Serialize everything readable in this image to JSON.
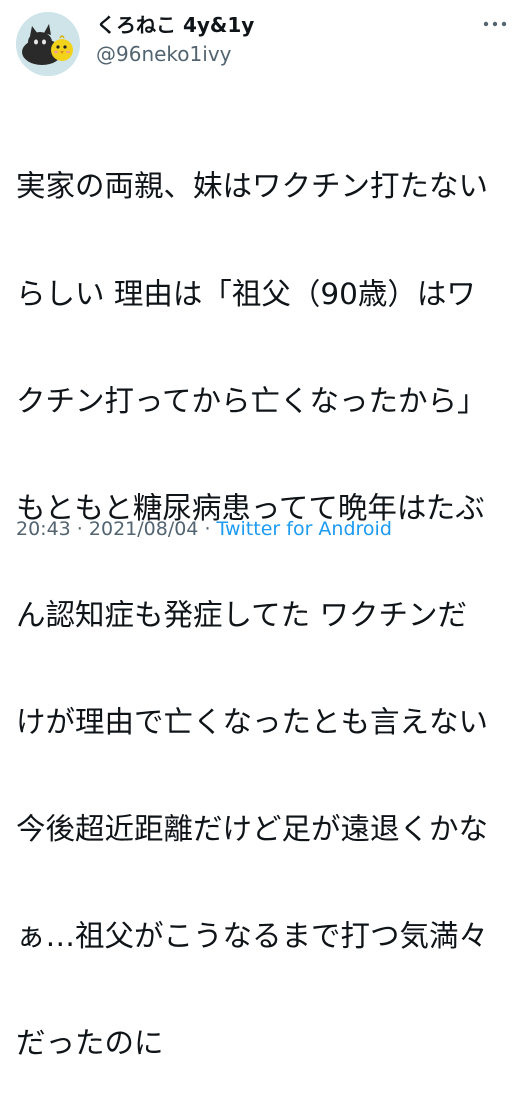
{
  "user": {
    "display_name": "くろねこ 4y&1y",
    "handle": "@96neko1ivy"
  },
  "tweet": {
    "lines": [
      "実家の両親、妹はワクチン打たない",
      "らしい 理由は「祖父（90歳）はワ",
      "クチン打ってから亡くなったから」",
      "もともと糖尿病患ってて晩年はたぶ",
      "ん認知症も発症してた ワクチンだ",
      "けが理由で亡くなったとも言えない",
      "今後超近距離だけど足が遠退くかな",
      "ぁ…祖父がこうなるまで打つ気満々",
      "だったのに"
    ]
  },
  "meta": {
    "time": "20:43",
    "separator1": " · ",
    "date": "2021/08/04",
    "separator2": " · ",
    "source": "Twitter for Android"
  },
  "icons": {
    "more": "more-dots-icon"
  },
  "colors": {
    "text": "#0f1419",
    "secondary": "#536471",
    "link": "#1d9bf0",
    "avatar_bg": "#cfe4e9"
  }
}
